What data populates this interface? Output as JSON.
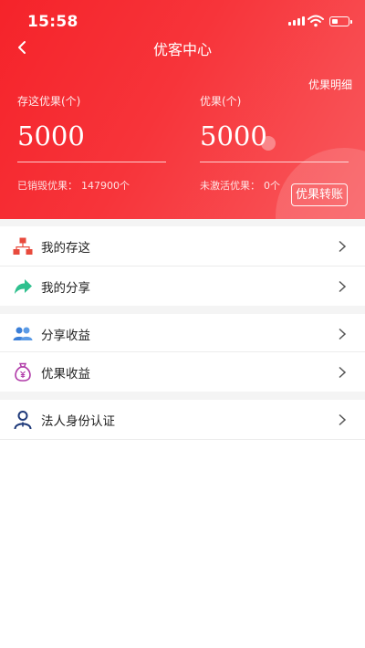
{
  "status_bar": {
    "time": "15:58"
  },
  "nav": {
    "title": "优客中心",
    "detail_link": "优果明细"
  },
  "stats": {
    "left": {
      "label": "存这优果(个)",
      "value": "5000",
      "sub_label": "已销毁优果：",
      "sub_value": "147900个"
    },
    "right": {
      "label": "优果(个)",
      "value": "5000",
      "sub_label": "未激活优果：",
      "sub_value": "0个"
    }
  },
  "transfer_button": "优果转账",
  "menu": {
    "group1": [
      {
        "label": "我的存这",
        "icon": "org-chart-icon"
      },
      {
        "label": "我的分享",
        "icon": "share-arrow-icon"
      }
    ],
    "group2": [
      {
        "label": "分享收益",
        "icon": "users-icon"
      },
      {
        "label": "优果收益",
        "icon": "money-bag-icon"
      }
    ],
    "group3": [
      {
        "label": "法人身份认证",
        "icon": "person-icon"
      }
    ]
  },
  "colors": {
    "header_red": "#f5232a",
    "org_icon_red": "#e84a3c",
    "share_icon_green": "#2fc08e",
    "users_icon_blue": "#3b7fd8",
    "bag_icon_purple": "#b03aa8",
    "person_icon_navy": "#1f3a7a"
  }
}
